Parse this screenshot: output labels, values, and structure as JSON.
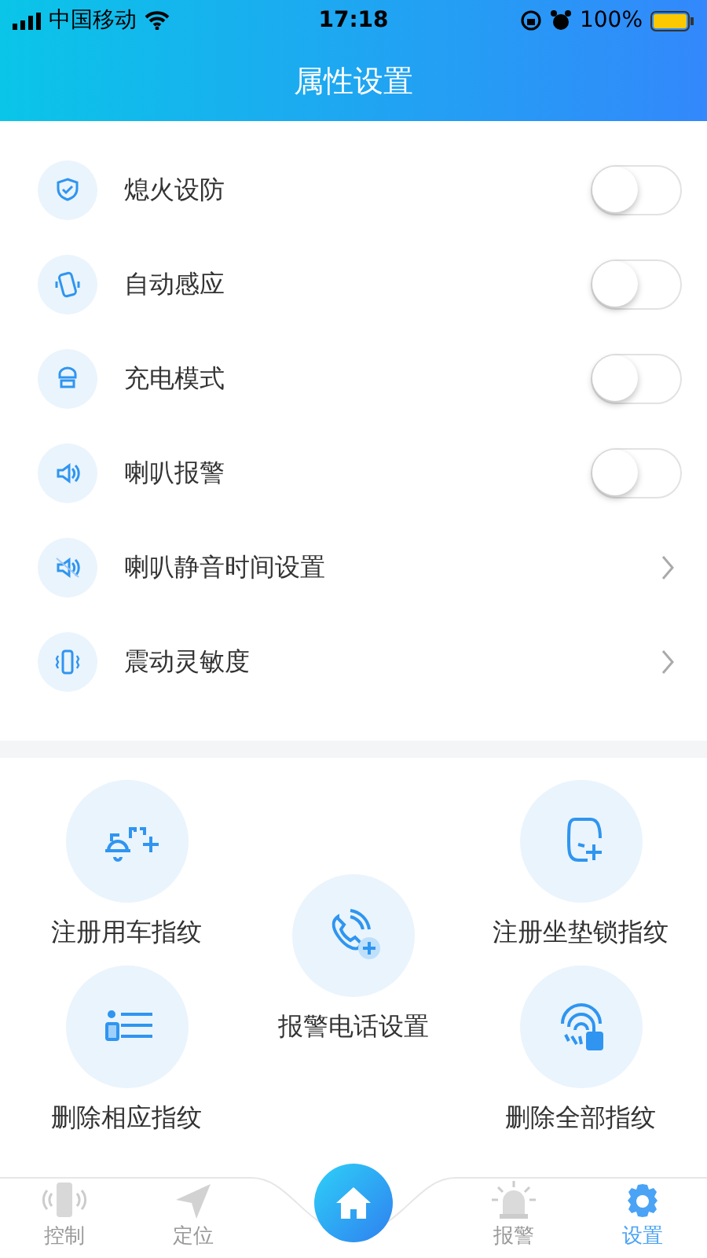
{
  "status_bar": {
    "carrier": "中国移动",
    "time": "17:18",
    "battery": "100%"
  },
  "header": {
    "title": "属性设置"
  },
  "settings": [
    {
      "label": "熄火设防",
      "kind": "toggle",
      "on": false
    },
    {
      "label": "自动感应",
      "kind": "toggle",
      "on": false
    },
    {
      "label": "充电模式",
      "kind": "toggle",
      "on": false
    },
    {
      "label": "喇叭报警",
      "kind": "toggle",
      "on": false
    },
    {
      "label": "喇叭静音时间设置",
      "kind": "link"
    },
    {
      "label": "震动灵敏度",
      "kind": "link"
    }
  ],
  "actions": [
    {
      "label": "注册用车指纹"
    },
    {
      "label": "删除相应指纹"
    },
    {
      "label": "报警电话设置"
    },
    {
      "label": "注册坐垫锁指纹"
    },
    {
      "label": "删除全部指纹"
    }
  ],
  "tab_bar": {
    "items": [
      {
        "label": "控制",
        "selected": false
      },
      {
        "label": "定位",
        "selected": false
      },
      {
        "label": "报警",
        "selected": false
      },
      {
        "label": "设置",
        "selected": true
      }
    ]
  }
}
